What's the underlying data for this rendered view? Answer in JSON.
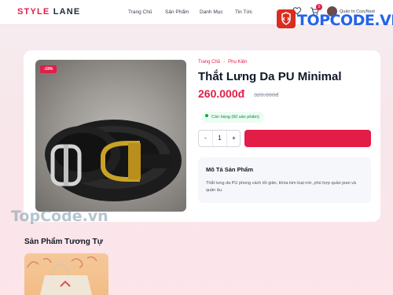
{
  "header": {
    "logo_part1": "STYLE",
    "logo_part2": "LANE",
    "nav": [
      "Trang Chủ",
      "Sản Phẩm",
      "Danh Mục",
      "Tin Tức"
    ],
    "cart_count": "0",
    "admin_name": "Quản trị CozyNest",
    "icons": [
      "heart-icon",
      "cart-icon",
      "avatar"
    ]
  },
  "watermark": {
    "top_text": "TOPCODE.VN",
    "bottom_text": "TopCode.vn"
  },
  "product": {
    "sale_badge": "-19%",
    "breadcrumb": [
      "Trang Chủ",
      "Phụ Kiện"
    ],
    "title": "Thắt Lưng Da PU Minimal",
    "price": "260.000đ",
    "old_price": "320.000đ",
    "stock": "Còn hàng (60 sản phẩm)",
    "quantity": "1",
    "qty_minus": "-",
    "qty_plus": "+",
    "description_title": "Mô Tả Sản Phẩm",
    "description_text": "Thắt lưng da PU phong cách tối giản, khóa kim loại mờ, phù hợp quần jean và quần âu."
  },
  "similar": {
    "title": "Sản Phẩm Tương Tự"
  },
  "colors": {
    "accent": "#e11d48",
    "stock_green": "#16a34a"
  }
}
